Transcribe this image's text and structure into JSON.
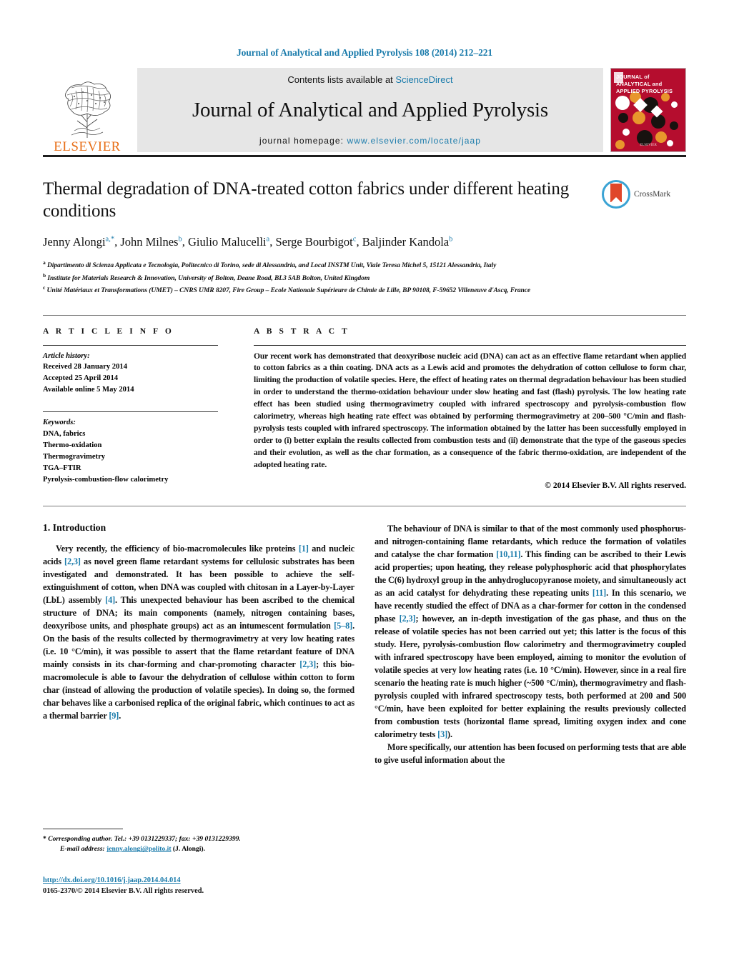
{
  "running_head": "Journal of Analytical and Applied Pyrolysis 108 (2014) 212–221",
  "masthead": {
    "publisher_name": "ELSEVIER",
    "contents_prefix": "Contents lists available at ",
    "contents_link": "ScienceDirect",
    "journal_name": "Journal of Analytical and Applied Pyrolysis",
    "homepage_prefix": "journal homepage: ",
    "homepage_url": "www.elsevier.com/locate/jaap",
    "cover_title_line1": "JOURNAL of",
    "cover_title_line2": "ANALYTICAL and",
    "cover_title_line3": "APPLIED PYROLYSIS",
    "cover_bottom": "ELSEVIER",
    "cover_color": "#b50d2e",
    "accent_color": "#1a7bab"
  },
  "article": {
    "title": "Thermal degradation of DNA-treated cotton fabrics under different heating conditions",
    "crossmark_label": "CrossMark",
    "authors": [
      {
        "name": "Jenny Alongi",
        "marks": "a,*"
      },
      {
        "name": "John Milnes",
        "marks": "b"
      },
      {
        "name": "Giulio Malucelli",
        "marks": "a"
      },
      {
        "name": "Serge Bourbigot",
        "marks": "c"
      },
      {
        "name": "Baljinder Kandola",
        "marks": "b"
      }
    ],
    "affiliations": [
      {
        "mark": "a",
        "text": "Dipartimento di Scienza Applicata e Tecnologia, Politecnico di Torino, sede di Alessandria, and Local INSTM Unit, Viale Teresa Michel 5, 15121 Alessandria, Italy"
      },
      {
        "mark": "b",
        "text": "Institute for Materials Research & Innovation, University of Bolton, Deane Road, BL3 5AB Bolton, United Kingdom"
      },
      {
        "mark": "c",
        "text": "Unité Matériaux et Transformations (UMET) – CNRS UMR 8207, Fire Group – Ecole Nationale Supérieure de Chimie de Lille, BP 90108, F-59652 Villeneuve d'Ascq, France"
      }
    ]
  },
  "article_info": {
    "heading": "A R T I C L E   I N F O",
    "history_label": "Article history:",
    "history": [
      "Received 28 January 2014",
      "Accepted 25 April 2014",
      "Available online 5 May 2014"
    ],
    "keywords_label": "Keywords:",
    "keywords": [
      "DNA, fabrics",
      "Thermo-oxidation",
      "Thermogravimetry",
      "TGA–FTIR",
      "Pyrolysis-combustion-flow calorimetry"
    ]
  },
  "abstract": {
    "heading": "A B S T R A C T",
    "text": "Our recent work has demonstrated that deoxyribose nucleic acid (DNA) can act as an effective flame retardant when applied to cotton fabrics as a thin coating. DNA acts as a Lewis acid and promotes the dehydration of cotton cellulose to form char, limiting the production of volatile species. Here, the effect of heating rates on thermal degradation behaviour has been studied in order to understand the thermo-oxidation behaviour under slow heating and fast (flash) pyrolysis. The low heating rate effect has been studied using thermogravimetry coupled with infrared spectroscopy and pyrolysis-combustion flow calorimetry, whereas high heating rate effect was obtained by performing thermogravimetry at 200–500 °C/min and flash-pyrolysis tests coupled with infrared spectroscopy. The information obtained by the latter has been successfully employed in order to (i) better explain the results collected from combustion tests and (ii) demonstrate that the type of the gaseous species and their evolution, as well as the char formation, as a consequence of the fabric thermo-oxidation, are independent of the adopted heating rate.",
    "copyright": "© 2014 Elsevier B.V. All rights reserved."
  },
  "body": {
    "section_title": "1. Introduction",
    "left_paragraph_1_a": "Very recently, the efficiency of bio-macromolecules like proteins ",
    "left_cite_1": "[1]",
    "left_paragraph_1_b": " and nucleic acids ",
    "left_cite_2": "[2,3]",
    "left_paragraph_1_c": " as novel green flame retardant systems for cellulosic substrates has been investigated and demonstrated. It has been possible to achieve the self-extinguishment of cotton, when DNA was coupled with chitosan in a Layer-by-Layer (LbL) assembly ",
    "left_cite_3": "[4]",
    "left_paragraph_1_d": ". This unexpected behaviour has been ascribed to the chemical structure of DNA; its main components (namely, nitrogen containing bases, deoxyribose units, and phosphate groups) act as an intumescent formulation ",
    "left_cite_4": "[5–8]",
    "left_paragraph_1_e": ". On the basis of the results collected by thermogravimetry at very low heating rates (i.e. 10 °C/min), it was possible to assert that the flame retardant feature of DNA mainly consists in its char-forming and char-promoting character ",
    "left_cite_5": "[2,3]",
    "left_paragraph_1_f": "; this bio-macromolecule is able to favour the dehydration of cellulose within cotton to form char (instead of allowing the production of volatile species). In doing so, the formed char behaves like a carbonised replica of the original fabric, which continues to act as a thermal barrier ",
    "left_cite_6": "[9]",
    "left_paragraph_1_g": ".",
    "right_paragraph_1_a": "The behaviour of DNA is similar to that of the most commonly used phosphorus- and nitrogen-containing flame retardants, which reduce the formation of volatiles and catalyse the char formation ",
    "right_cite_1": "[10,11]",
    "right_paragraph_1_b": ". This finding can be ascribed to their Lewis acid properties; upon heating, they release polyphosphoric acid that phosphorylates the C(6) hydroxyl group in the anhydroglucopyranose moiety, and simultaneously act as an acid catalyst for dehydrating these repeating units ",
    "right_cite_2": "[11]",
    "right_paragraph_1_c": ". In this scenario, we have recently studied the effect of DNA as a char-former for cotton in the condensed phase ",
    "right_cite_3": "[2,3]",
    "right_paragraph_1_d": "; however, an in-depth investigation of the gas phase, and thus on the release of volatile species has not been carried out yet; this latter is the focus of this study. Here, pyrolysis-combustion flow calorimetry and thermogravimetry coupled with infrared spectroscopy have been employed, aiming to monitor the evolution of volatile species at very low heating rates (i.e. 10 °C/min). However, since in a real fire scenario the heating rate is much higher (~500 °C/min), thermogravimetry and flash-pyrolysis coupled with infrared spectroscopy tests, both performed at 200 and 500 °C/min, have been exploited for better explaining the results previously collected from combustion tests (horizontal flame spread, limiting oxygen index and cone calorimetry tests ",
    "right_cite_4": "[3]",
    "right_paragraph_1_e": ").",
    "right_paragraph_2": "More specifically, our attention has been focused on performing tests that are able to give useful information about the"
  },
  "footer": {
    "corresponding_star": "*",
    "corresponding_text": "Corresponding author. Tel.: +39 0131229337; fax: +39 0131229399.",
    "email_label": "E-mail address: ",
    "email": "jenny.alongi@polito.it",
    "email_suffix": " (J. Alongi).",
    "doi": "http://dx.doi.org/10.1016/j.jaap.2014.04.014",
    "issn_line": "0165-2370/© 2014 Elsevier B.V. All rights reserved."
  }
}
